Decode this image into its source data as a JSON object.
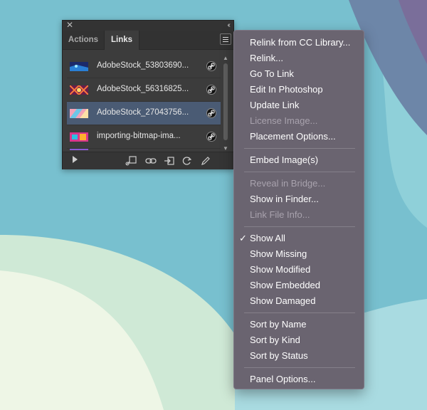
{
  "panel": {
    "tabs": [
      {
        "label": "Actions"
      },
      {
        "label": "Links"
      }
    ],
    "links": [
      {
        "name": "AdobeStock_53803690..."
      },
      {
        "name": "AdobeStock_56316825..."
      },
      {
        "name": "AdobeStock_27043756..."
      },
      {
        "name": "importing-bitmap-ima..."
      }
    ],
    "footer_icons": [
      "play-icon",
      "relink-cc-icon",
      "relink-icon",
      "goto-link-icon",
      "update-link-icon",
      "edit-original-icon"
    ]
  },
  "menu": {
    "group1": [
      "Relink from CC Library...",
      "Relink...",
      "Go To Link",
      "Edit In Photoshop",
      "Update Link",
      "License Image...",
      "Placement Options..."
    ],
    "group2": [
      "Embed Image(s)"
    ],
    "group3": [
      "Reveal in Bridge...",
      "Show in Finder...",
      "Link File Info..."
    ],
    "group4": [
      "Show All",
      "Show Missing",
      "Show Modified",
      "Show Embedded",
      "Show Damaged"
    ],
    "group5": [
      "Sort by Name",
      "Sort by Kind",
      "Sort by Status"
    ],
    "group6": [
      "Panel Options..."
    ],
    "checkmark": "✓"
  },
  "colors": {
    "menu_bg": "#6a6470",
    "selected_row": "#4a5b74",
    "disabled_text": "#a8a2ad"
  }
}
